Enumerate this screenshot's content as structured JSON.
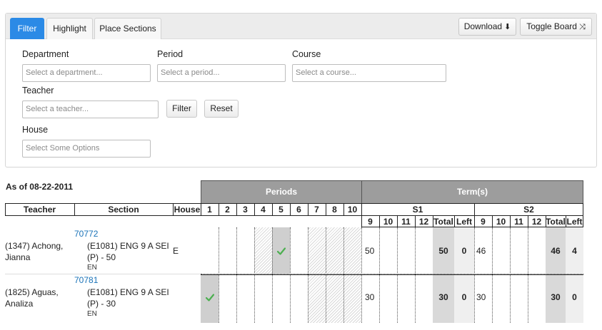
{
  "tabs": [
    {
      "label": "Filter",
      "active": true
    },
    {
      "label": "Highlight",
      "active": false
    },
    {
      "label": "Place Sections",
      "active": false
    }
  ],
  "toolbar": {
    "download_label": "Download",
    "toggle_board_label": "Toggle Board",
    "download_icon": "download-circle-icon",
    "toggle_icon": "shuffle-icon",
    "accent_color": "#2b8ae6"
  },
  "filters": {
    "department": {
      "label": "Department",
      "placeholder": "Select a department..."
    },
    "period": {
      "label": "Period",
      "placeholder": "Select a period..."
    },
    "course": {
      "label": "Course",
      "placeholder": "Select a course..."
    },
    "teacher": {
      "label": "Teacher",
      "placeholder": "Select a teacher..."
    },
    "house": {
      "label": "House",
      "placeholder": "Select Some Options"
    },
    "filter_button": "Filter",
    "reset_button": "Reset"
  },
  "table": {
    "as_of": "As of 08-22-2011",
    "headers": {
      "teacher": "Teacher",
      "section": "Section",
      "house": "House",
      "periods": "Periods",
      "terms": "Term(s)",
      "s1": "S1",
      "s2": "S2"
    },
    "periods": [
      "1",
      "2",
      "3",
      "4",
      "5",
      "6",
      "7",
      "8",
      "10"
    ],
    "term_cols": [
      "9",
      "10",
      "11",
      "12",
      "Total",
      "Left"
    ],
    "rows": [
      {
        "teacher": "(1347) Achong, Jianna",
        "section_id": "70772",
        "section_desc": "(E1081) ENG 9 A SEI (P) - 50",
        "lang": "EN",
        "house": "E",
        "s1": {
          "g9": "50",
          "total": "50",
          "left": "0"
        },
        "s2": {
          "g9": "46",
          "total": "46",
          "left": "4"
        }
      },
      {
        "teacher": "(1825) Aguas, Analiza",
        "section_id": "70781",
        "section_desc": "(E1081) ENG 9 A SEI (P) - 30",
        "lang": "EN",
        "house": "",
        "s1": {
          "g9": "30",
          "total": "30",
          "left": "0"
        },
        "s2": {
          "g9": "30",
          "total": "30",
          "left": "0"
        }
      }
    ]
  }
}
